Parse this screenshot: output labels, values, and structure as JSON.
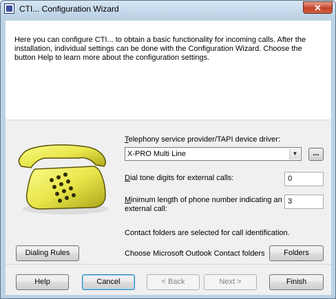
{
  "window": {
    "title": "CTI... Configuration Wizard",
    "close_glyph": "✕"
  },
  "intro": {
    "text": "Here you can configure CTI... to obtain a basic functionality for incoming calls. After the installation, individual settings can be done with the Configuration Wizard. Choose the button Help to learn more about the configuration settings."
  },
  "provider": {
    "label_access": "T",
    "label_rest": "elephony service provider/TAPI device driver:",
    "selected": "X-PRO Multi Line",
    "browse_label": "..."
  },
  "dial_tone": {
    "label_access": "D",
    "label_rest": "ial tone digits for external calls:",
    "value": "0"
  },
  "min_length": {
    "label_access": "M",
    "label_rest": "inimum length of phone number indicating an",
    "label_line2": "external call:",
    "value": "3"
  },
  "contacts": {
    "info": "Contact folders are selected for call identification.",
    "choose_label": "Choose Microsoft Outlook Contact folders",
    "folders_button": "Folders"
  },
  "dialing_rules_button": "Dialing Rules",
  "footer": {
    "help": "Help",
    "cancel": "Cancel",
    "back": "< Back",
    "next": "Next >",
    "finish": "Finish"
  },
  "icons": {
    "app": "wizard-app-icon",
    "phone": "telephone-icon"
  },
  "colors": {
    "phone_body": "#e8e64a",
    "default_button_border": "#3c7fb1",
    "close_button": "#c6432a"
  }
}
